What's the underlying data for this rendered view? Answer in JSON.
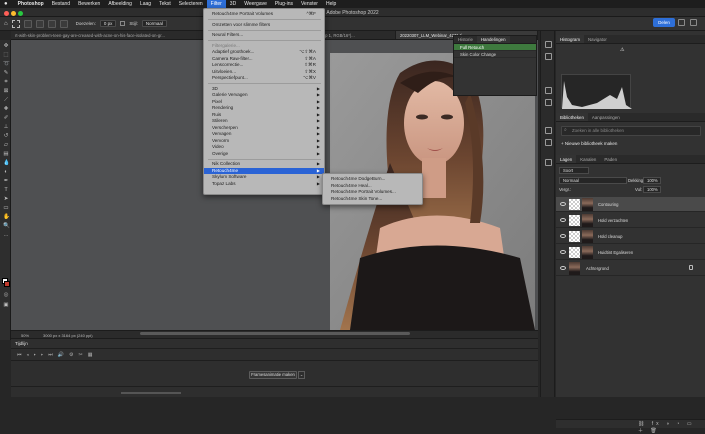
{
  "menubar": {
    "apple": "",
    "items": [
      "Photoshop",
      "Bestand",
      "Bewerken",
      "Afbeelding",
      "Laag",
      "Tekst",
      "Selecteren",
      "Filter",
      "3D",
      "Weergave",
      "Plug-ins",
      "Venster",
      "Help"
    ],
    "active_item": "Filter"
  },
  "window": {
    "title": "Adobe Photoshop 2022"
  },
  "options": {
    "doezelen_label": "Doezelen:",
    "doezelen_value": "0 px",
    "stijl_label": "Stijl:",
    "stijl_value": "Normaal",
    "share_label": "Delen"
  },
  "tabs": [
    "rt-with-skin-problem-teen-gay-are-creased-with-acne-on-his-face-isolated-on-gr...",
    "20220307_LLM_Webinar_2.tif @ 100% (Groep 1, RGB/16*)...",
    "20220307_LLM_Webinar_4271.ti..."
  ],
  "filter_menu": {
    "items": [
      {
        "label": "Retouch4me Portrait Volumes",
        "shortcut": "^⌘F"
      },
      {
        "sep": true
      },
      {
        "label": "Omzetten voor slimme filters"
      },
      {
        "sep": true
      },
      {
        "label": "Neural Filters..."
      },
      {
        "sep": true
      },
      {
        "label": "Filtergalerie...",
        "disabled": true
      },
      {
        "label": "Adaptief groothoek...",
        "shortcut": "⌥⇧⌘A"
      },
      {
        "label": "Camera Raw-filter...",
        "shortcut": "⇧⌘A"
      },
      {
        "label": "Lenscorrectie...",
        "shortcut": "⇧⌘R"
      },
      {
        "label": "Uitvloeien...",
        "shortcut": "⇧⌘X"
      },
      {
        "label": "Perspectiefpunt...",
        "shortcut": "⌥⌘V"
      },
      {
        "sep": true
      },
      {
        "label": "3D",
        "submenu": true
      },
      {
        "label": "Galerie Vervagen",
        "submenu": true
      },
      {
        "label": "Pixel",
        "submenu": true
      },
      {
        "label": "Rendering",
        "submenu": true
      },
      {
        "label": "Ruis",
        "submenu": true
      },
      {
        "label": "Stileren",
        "submenu": true
      },
      {
        "label": "Verscherpen",
        "submenu": true
      },
      {
        "label": "Vervagen",
        "submenu": true
      },
      {
        "label": "Vervorm",
        "submenu": true
      },
      {
        "label": "Video",
        "submenu": true
      },
      {
        "label": "Overige",
        "submenu": true
      },
      {
        "sep": true
      },
      {
        "label": "Nik Collection",
        "submenu": true
      },
      {
        "label": "Retouch4me",
        "submenu": true,
        "highlighted": true
      },
      {
        "label": "Skylum Software",
        "submenu": true
      },
      {
        "label": "Topaz Labs",
        "submenu": true
      }
    ]
  },
  "retouch_submenu": [
    "Retouch4me DodgeBurn...",
    "Retouch4me Heal...",
    "Retouch4me Portrait Volumes...",
    "Retouch4me Skin Tone..."
  ],
  "actions_panel": {
    "tabs": [
      "Historie",
      "Handelingen"
    ],
    "active_tab": "Handelingen",
    "rows": [
      "Full Retouch",
      "Skin Color Change"
    ],
    "selected": "Full Retouch"
  },
  "status": {
    "zoom": "50%",
    "doc": "3000 px x 3164 px (240 ppi)"
  },
  "timeline": {
    "title": "Tijdlijn",
    "button": "Framesanimatie maken"
  },
  "right": {
    "histogram_tabs": [
      "Histogram",
      "Navigator"
    ],
    "library_tabs": [
      "Bibliotheken",
      "Aanpassingen"
    ],
    "library_search": "Zoeken in alle bibliotheken",
    "new_library": "Nieuwe bibliotheek maken",
    "library_name": "Uw bibliotheek",
    "layer_tabs": [
      "Lagen",
      "Kanalen",
      "Paden"
    ],
    "search_label": "Soort",
    "blend": "Normaal",
    "opacity_label": "Dekking:",
    "opacity": "100%",
    "lock_label": "Vergr.:",
    "fill_label": "Vul:",
    "fill": "100%",
    "layers": [
      {
        "name": "Contouring",
        "selected": true
      },
      {
        "name": "Hold verzachten"
      },
      {
        "name": "Hold cleanup"
      },
      {
        "name": "Huidtint Egaliseren"
      },
      {
        "name": "Achtergrond",
        "locked": true
      }
    ]
  },
  "colors": {
    "accent": "#2e6fd8",
    "menu_bg": "#b8b8b8",
    "highlight": "#2a63d5",
    "action_selected": "#3e7a3e"
  }
}
